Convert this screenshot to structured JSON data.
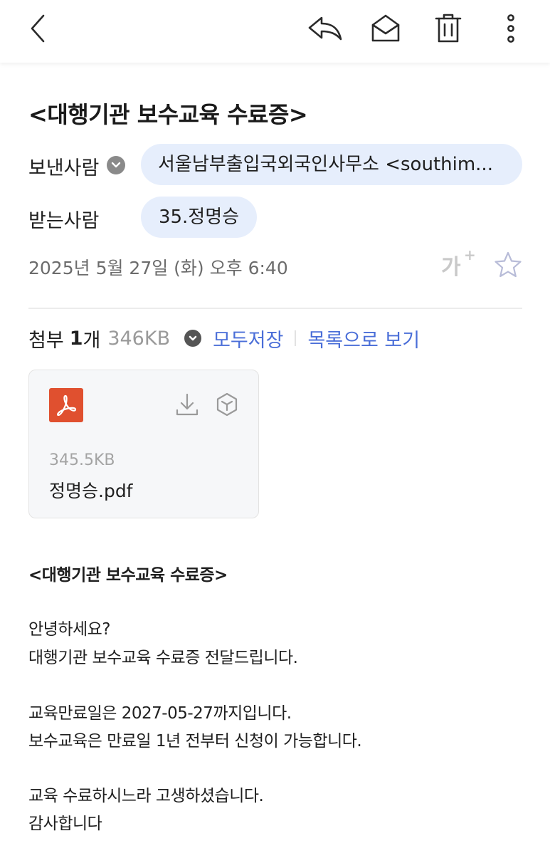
{
  "toolbar": {
    "back_icon": "chevron-left-icon",
    "reply_icon": "reply-icon",
    "read_icon": "open-envelope-icon",
    "delete_icon": "trash-icon",
    "more_icon": "more-vertical-icon"
  },
  "mail": {
    "subject": "<대행기관 보수교육 수료증>",
    "sender_label": "보낸사람",
    "sender": "서울남부출입국외국인사무소 <southim...",
    "receiver_label": "받는사람",
    "receiver": "35.정명승",
    "date": "2025년 5월 27일 (화) 오후 6:40",
    "font_size_label": "가",
    "font_size_plus": "+"
  },
  "attachments": {
    "label": "첨부",
    "count": "1",
    "count_unit": "개",
    "total_size": "346KB",
    "save_all": "모두저장",
    "view_list": "목록으로 보기",
    "files": [
      {
        "size": "345.5KB",
        "name": "정명승.pdf"
      }
    ]
  },
  "body": {
    "title": "<대행기관 보수교육 수료증>",
    "lines": [
      "안녕하세요?",
      "대행기관 보수교육 수료증 전달드립니다.",
      "교육만료일은 2027-05-27까지입니다.",
      "보수교육은 만료일 1년 전부터 신청이 가능합니다.",
      "교육 수료하시느라 고생하셨습니다.",
      "감사합니다"
    ]
  },
  "colors": {
    "accent_link": "#4a6ed8",
    "chip_bg": "#e6eefc",
    "pdf_icon_bg": "#e0502f"
  }
}
